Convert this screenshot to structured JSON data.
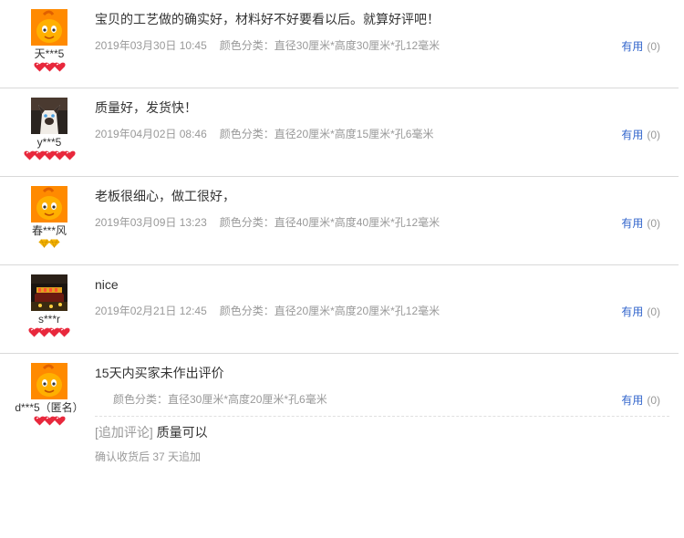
{
  "reviews": [
    {
      "username": "天***5",
      "avatar": "taobao-orange-mascot",
      "rank_icons": "red-heart-x3",
      "text": "宝贝的工艺做的确实好，材料好不好要看以后。就算好评吧！",
      "date": "2019年03月30日 10:45",
      "sku": "颜色分类：直径30厘米*高度30厘米*孔12毫米",
      "useful_label": "有用",
      "useful_count": "(0)"
    },
    {
      "username": "y***5",
      "avatar": "cat-photo",
      "rank_icons": "red-heart-x5",
      "text": "质量好，发货快！",
      "date": "2019年04月02日 08:46",
      "sku": "颜色分类：直径20厘米*高度15厘米*孔6毫米",
      "useful_label": "有用",
      "useful_count": "(0)"
    },
    {
      "username": "春***风",
      "avatar": "taobao-orange-mascot",
      "rank_icons": "yellow-diamond-x2",
      "text": "老板很细心，做工很好，",
      "date": "2019年03月09日 13:23",
      "sku": "颜色分类：直径40厘米*高度40厘米*孔12毫米",
      "useful_label": "有用",
      "useful_count": "(0)"
    },
    {
      "username": "s***r",
      "avatar": "night-scene-photo",
      "rank_icons": "red-heart-x4",
      "text": "nice",
      "date": "2019年02月21日 12:45",
      "sku": "颜色分类：直径20厘米*高度20厘米*孔12毫米",
      "useful_label": "有用",
      "useful_count": "(0)"
    },
    {
      "username": "d***5（匿名）",
      "avatar": "taobao-orange-mascot",
      "rank_icons": "red-heart-x3",
      "text": "15天内买家未作出评价",
      "sku": "颜色分类：直径30厘米*高度20厘米*孔6毫米",
      "useful_label": "有用",
      "useful_count": "(0)",
      "append_tag": "[追加评论]",
      "append_text": "质量可以",
      "append_time": "确认收货后 37 天追加"
    }
  ],
  "colors": {
    "link": "#3366cc",
    "muted": "#999999",
    "divider": "#d9d9d9",
    "mascot_orange": "#ff8a00",
    "heart_red": "#e8283c",
    "diamond_yellow": "#f5b400"
  }
}
